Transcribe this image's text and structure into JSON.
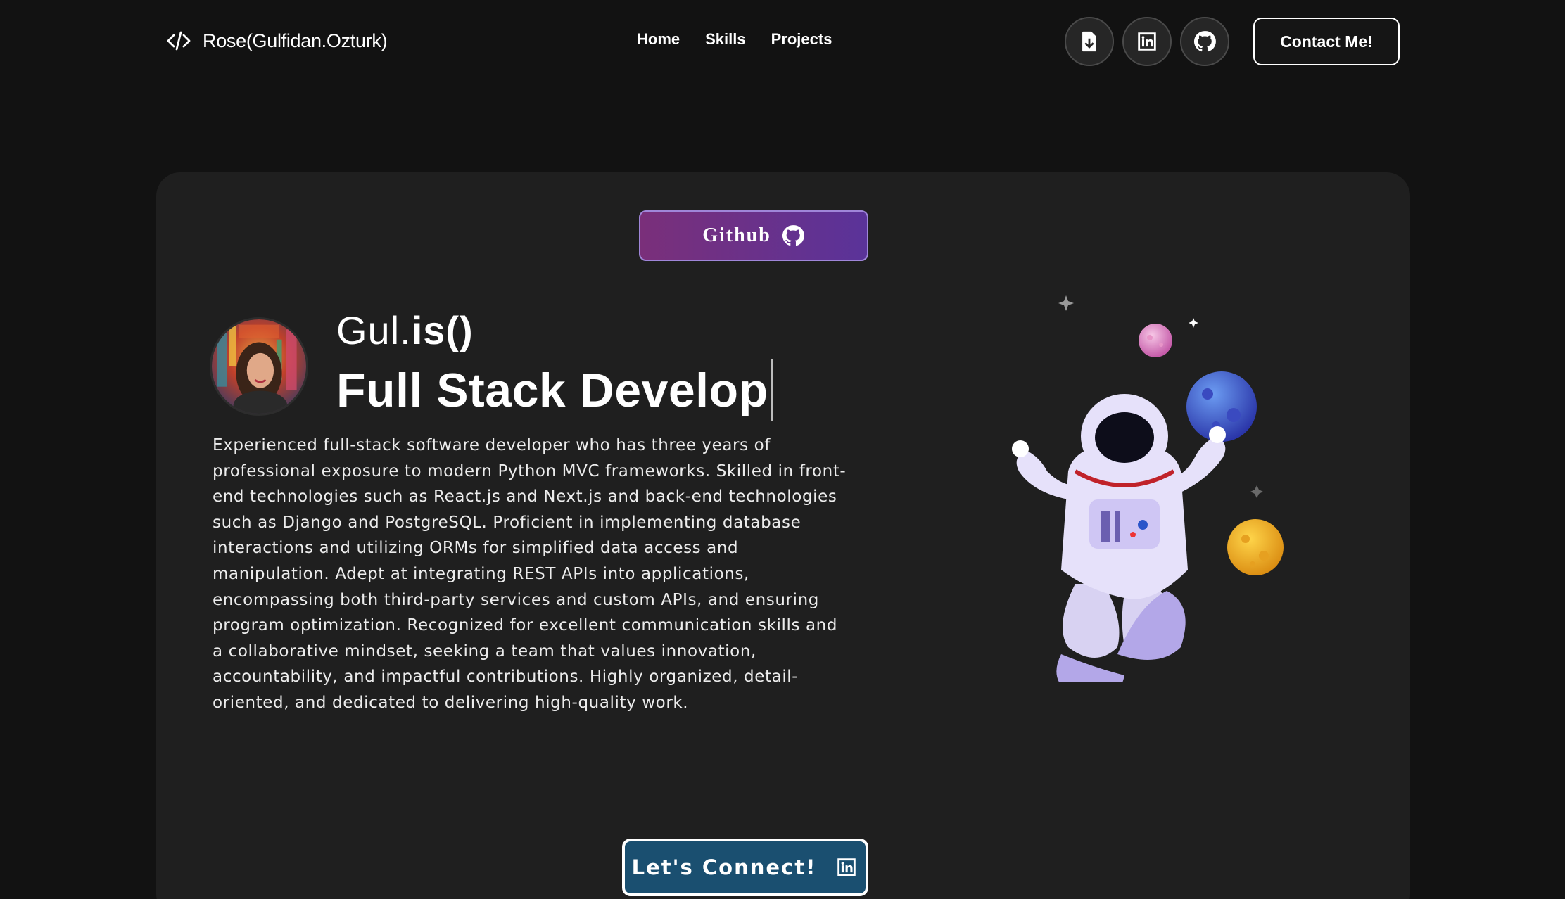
{
  "nav": {
    "logo_text": "Rose(Gulfidan.Ozturk)",
    "links": [
      "Home",
      "Skills",
      "Projects"
    ],
    "icon_buttons": [
      "download-resume-icon",
      "linkedin-icon",
      "github-icon"
    ],
    "contact_label": "Contact Me!"
  },
  "hero": {
    "github_label": "Github",
    "greeting_prefix": "Gul.",
    "greeting_suffix": "is()",
    "role": "Full Stack Develop",
    "bio": "Experienced full-stack software developer who has three years of professional exposure to modern Python MVC frameworks. Skilled in front-end technologies such as React.js and Next.js and back-end technologies such as Django and PostgreSQL. Proficient in implementing database interactions and utilizing ORMs for simplified data access and manipulation. Adept at integrating REST APIs into applications, encompassing both third-party services and custom APIs, and ensuring program optimization. Recognized for excellent communication skills and a collaborative mindset, seeking a team that values innovation, accountability, and impactful contributions. Highly organized, detail-oriented, and dedicated to delivering high-quality work.",
    "connect_label": "Let's Connect!"
  },
  "colors": {
    "page_bg": "#121212",
    "card_bg": "#1f1f1f",
    "github_gradient_start": "#7a2f7a",
    "github_gradient_end": "#5a3399",
    "connect_bg": "#1a4f70"
  }
}
